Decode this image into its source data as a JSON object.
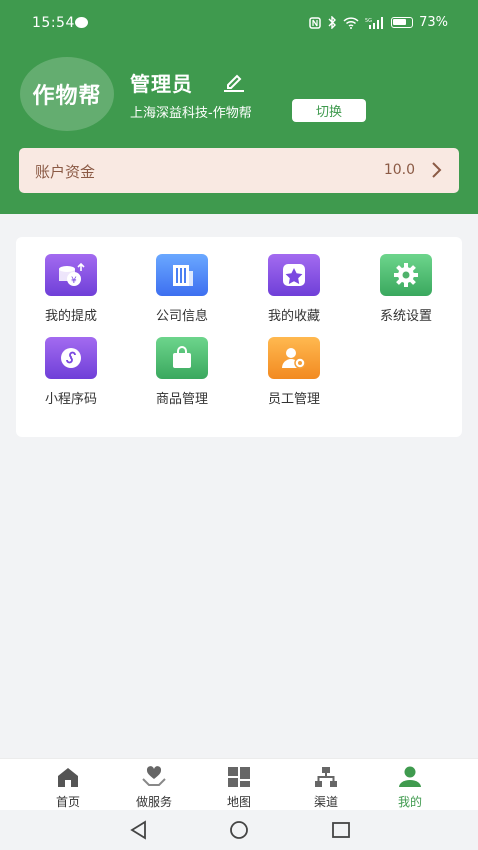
{
  "status": {
    "time": "15:54",
    "battery": "73%"
  },
  "profile": {
    "avatar_text": "作物帮",
    "name": "管理员",
    "company": "上海深益科技-作物帮",
    "switch_label": "切换"
  },
  "funds": {
    "label": "账户资金",
    "value": "10.0"
  },
  "menu": [
    {
      "label": "我的提成",
      "icon": "coin-stack-icon",
      "color": "purple"
    },
    {
      "label": "公司信息",
      "icon": "building-icon",
      "color": "blue"
    },
    {
      "label": "我的收藏",
      "icon": "star-icon",
      "color": "purple"
    },
    {
      "label": "系统设置",
      "icon": "gear-icon",
      "color": "green"
    },
    {
      "label": "小程序码",
      "icon": "mini-program-icon",
      "color": "purple"
    },
    {
      "label": "商品管理",
      "icon": "shopping-bag-icon",
      "color": "green"
    },
    {
      "label": "员工管理",
      "icon": "staff-icon",
      "color": "orange"
    }
  ],
  "tabs": [
    {
      "label": "首页",
      "icon": "home-icon"
    },
    {
      "label": "做服务",
      "icon": "heart-hand-icon"
    },
    {
      "label": "地图",
      "icon": "map-icon"
    },
    {
      "label": "渠道",
      "icon": "org-chart-icon"
    },
    {
      "label": "我的",
      "icon": "user-icon",
      "active": true
    }
  ],
  "colors": {
    "brand_green": "#3f9a4e",
    "funds_bg": "#f9e9e2",
    "funds_text": "#8b5a45"
  }
}
